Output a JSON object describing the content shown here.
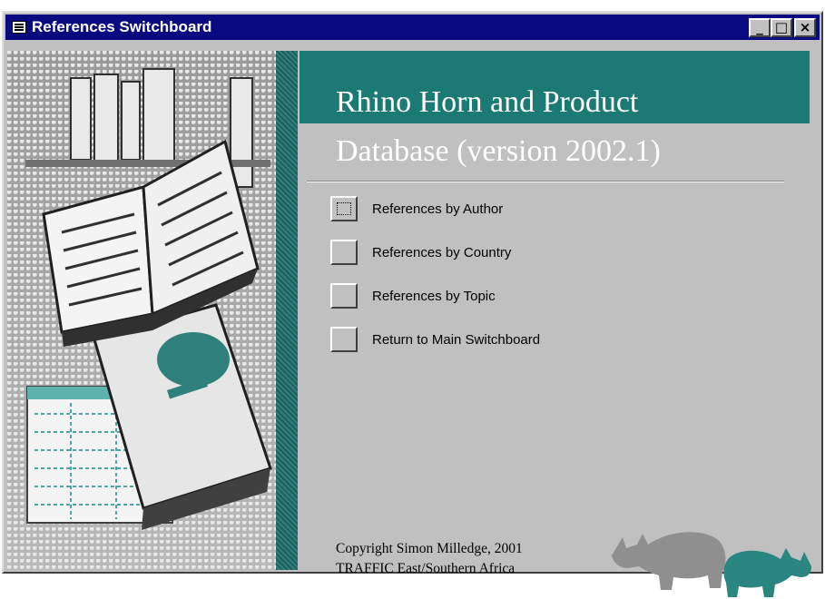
{
  "window": {
    "title": "References Switchboard",
    "icon": "form-icon",
    "controls": {
      "minimize": "_",
      "maximize": "□",
      "close": "×"
    }
  },
  "header": {
    "line1": "Rhino Horn and Product",
    "line2": "Database (version 2002.1)"
  },
  "menu": {
    "items": [
      {
        "label": "References by Author"
      },
      {
        "label": "References by Country"
      },
      {
        "label": "References by Topic"
      },
      {
        "label": "Return to Main Switchboard"
      }
    ]
  },
  "footer": {
    "line1": "Copyright Simon Milledge, 2001",
    "line2": "TRAFFIC East/Southern Africa"
  },
  "colors": {
    "titlebar": "#0a0a80",
    "accent_teal": "#1c7a74",
    "face": "#c0c0c0"
  },
  "icons": {
    "side_art": "books-illustration",
    "rhino_left": "rhino-icon",
    "rhino_right": "rhino-icon"
  }
}
